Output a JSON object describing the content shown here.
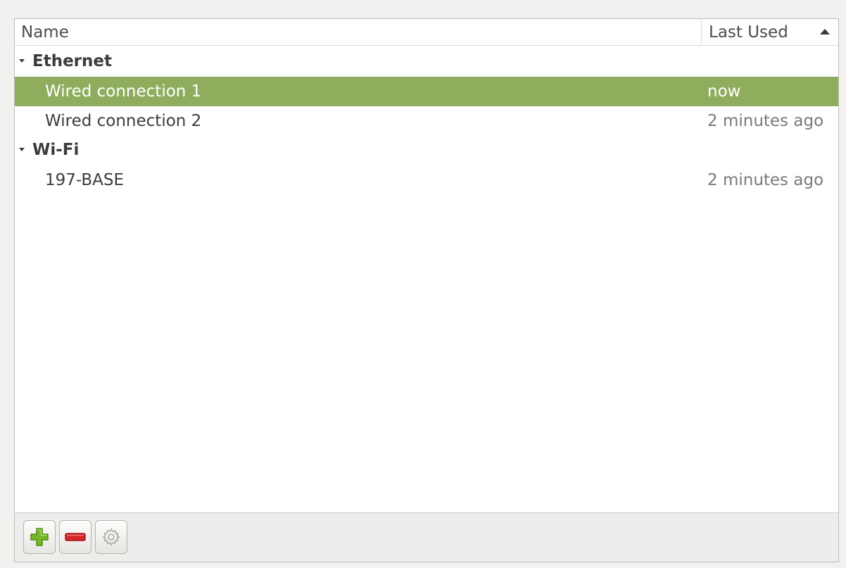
{
  "header": {
    "name_label": "Name",
    "last_used_label": "Last Used"
  },
  "groups": [
    {
      "label": "Ethernet",
      "items": [
        {
          "name": "Wired connection 1",
          "last_used": "now",
          "selected": true
        },
        {
          "name": "Wired connection 2",
          "last_used": "2 minutes ago",
          "selected": false
        }
      ]
    },
    {
      "label": "Wi-Fi",
      "items": [
        {
          "name": "197-BASE",
          "last_used": "2 minutes ago",
          "selected": false
        }
      ]
    }
  ],
  "toolbar": {
    "add_icon": "plus-icon",
    "remove_icon": "minus-icon",
    "settings_icon": "gear-icon"
  },
  "colors": {
    "selection": "#8fad5d",
    "add": "#73b72a",
    "remove": "#d7282a"
  }
}
